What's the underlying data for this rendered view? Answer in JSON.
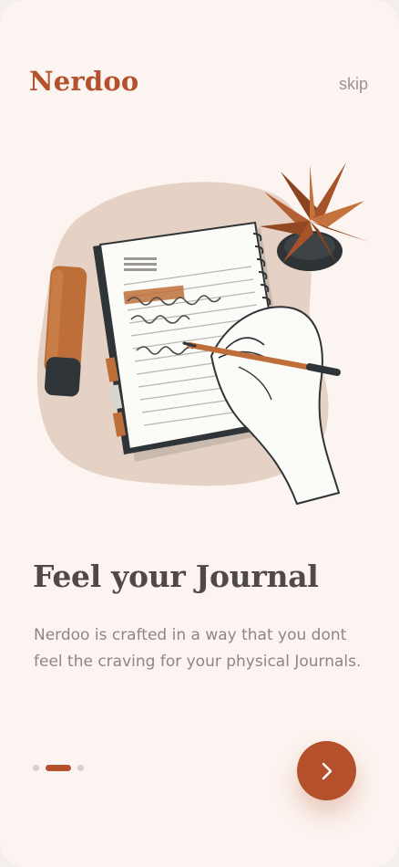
{
  "header": {
    "brand": "Nerdoo",
    "skip_label": "skip"
  },
  "onboarding": {
    "title": "Feel your Journal",
    "description": "Nerdoo is crafted in a way that you dont feel the craving for your physical Journals.",
    "page_count": 3,
    "active_page": 2
  },
  "icons": {
    "next": "chevron-right-icon",
    "illustration": "journal-writing-illustration"
  },
  "colors": {
    "accent": "#b4512c",
    "background": "#fcf4f0",
    "title": "#4f4a46",
    "body": "#8c8783",
    "inactive_dot": "#d6d0cc"
  }
}
